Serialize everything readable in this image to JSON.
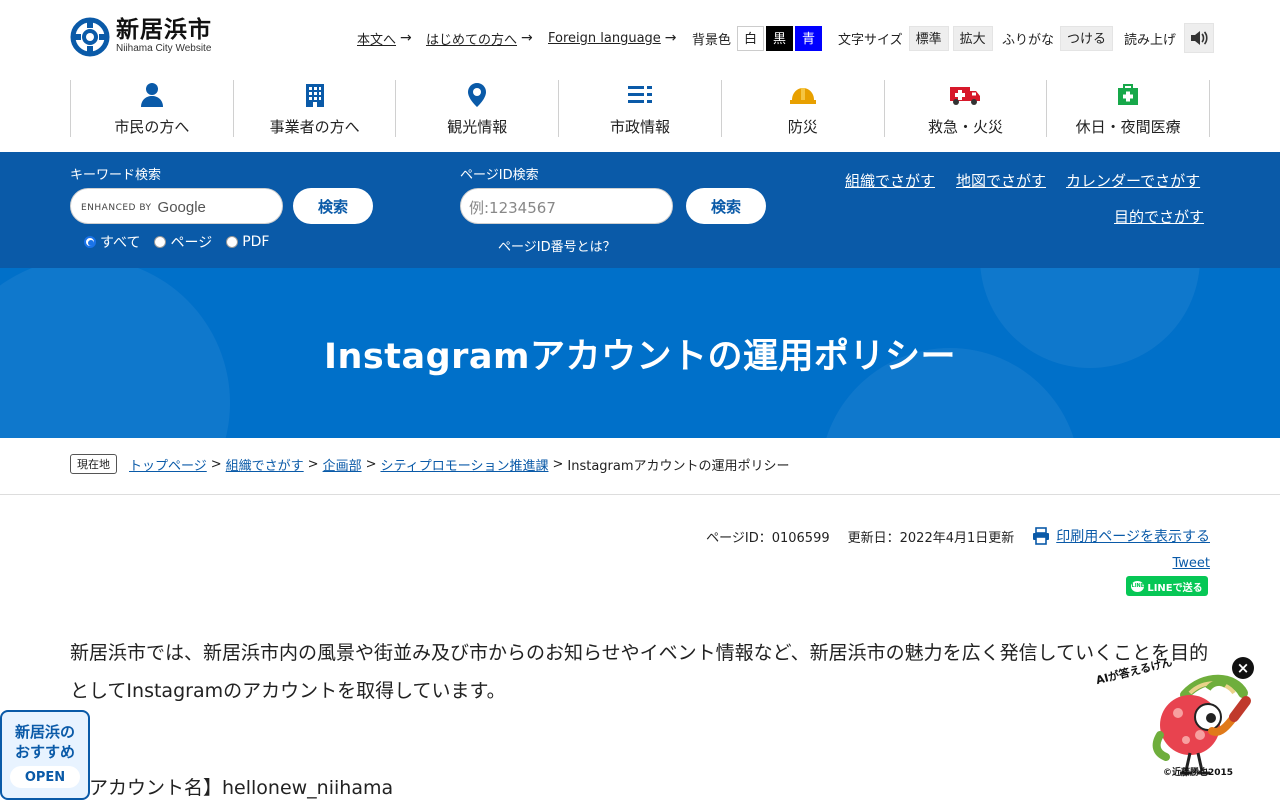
{
  "logo": {
    "name": "新居浜市",
    "subtitle": "Niihama City Website"
  },
  "utility": {
    "links": [
      {
        "label": "本文へ"
      },
      {
        "label": "はじめての方へ"
      },
      {
        "label": "Foreign language"
      }
    ],
    "bg_label": "背景色",
    "bg_options": [
      "白",
      "黒",
      "青"
    ],
    "text_size_label": "文字サイズ",
    "text_size_options": [
      "標準",
      "拡大"
    ],
    "furigana_label": "ふりがな",
    "furigana_option": "つける",
    "read_aloud_label": "読み上げ"
  },
  "gnav": [
    {
      "label": "市民の方へ",
      "icon": "person-icon"
    },
    {
      "label": "事業者の方へ",
      "icon": "building-icon"
    },
    {
      "label": "観光情報",
      "icon": "map-pin-icon"
    },
    {
      "label": "市政情報",
      "icon": "list-icon"
    },
    {
      "label": "防災",
      "icon": "helmet-icon"
    },
    {
      "label": "救急・火災",
      "icon": "ambulance-icon"
    },
    {
      "label": "休日・夜間医療",
      "icon": "first-aid-icon"
    }
  ],
  "search": {
    "keyword_label": "キーワード検索",
    "google_enhanced": "ENHANCED BY",
    "google_brand": "Google",
    "search_button": "検索",
    "scopes": [
      "すべて",
      "ページ",
      "PDF"
    ],
    "page_id_label": "ページID検索",
    "page_id_placeholder": "例:1234567",
    "page_id_button": "検索",
    "page_id_help": "ページID番号とは？",
    "quick_links": [
      "組織でさがす",
      "地図でさがす",
      "カレンダーでさがす",
      "目的でさがす"
    ]
  },
  "hero": {
    "title": "Instagramアカウントの運用ポリシー"
  },
  "breadcrumb": {
    "here_label": "現在地",
    "links": [
      "トップページ",
      "組織でさがす",
      "企画部",
      "シティプロモーション推進課"
    ],
    "current": "Instagramアカウントの運用ポリシー"
  },
  "meta": {
    "page_id": "ページID：0106599",
    "updated": "更新日：2022年4月1日更新",
    "print_link": "印刷用ページを表示する",
    "tweet": "Tweet",
    "line": "LINEで送る"
  },
  "content": {
    "intro": "新居浜市では、新居浜市内の風景や街並み及び市からのお知らせやイベント情報など、新居浜市の魅力を広く発信していくことを目的としてInstagramのアカウントを取得しています。",
    "account": "【アカウント名】hellonew_niihama"
  },
  "recommend": {
    "line1": "新居浜の",
    "line2": "おすすめ",
    "open": "OPEN"
  },
  "ai_widget": {
    "label": "AIが答えるけん",
    "close": "×",
    "copyright": "©近藤勝也2015"
  },
  "colors": {
    "brand_blue": "#0a5aa8",
    "hero_blue": "#0070c9",
    "line_green": "#06c755"
  }
}
